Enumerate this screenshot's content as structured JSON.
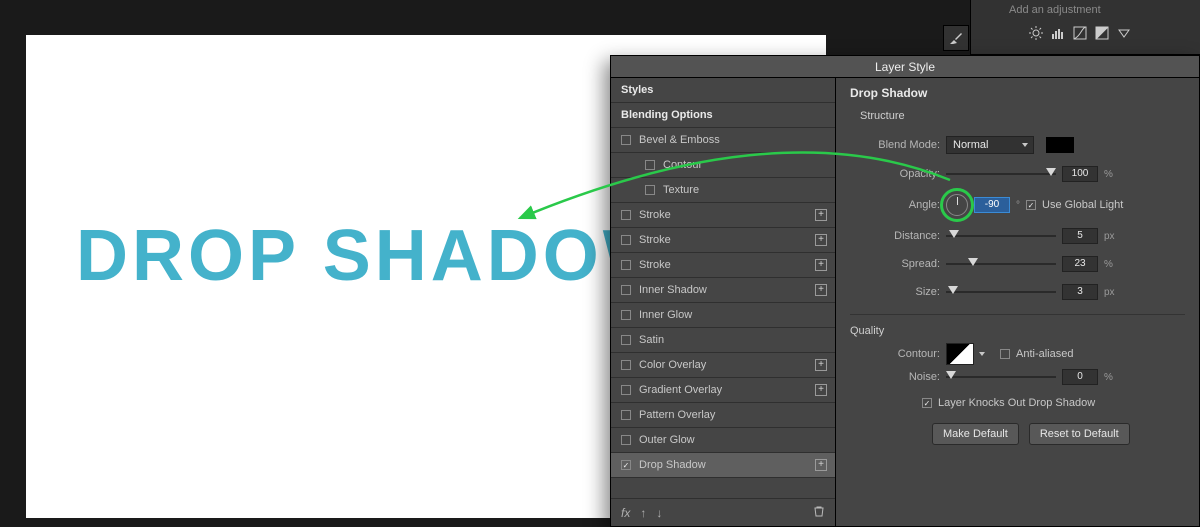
{
  "canvas": {
    "text": "DROP SHADOWS"
  },
  "adjustments": {
    "hint": "Add an adjustment"
  },
  "dialog": {
    "title": "Layer Style",
    "sidebar": {
      "header_styles": "Styles",
      "header_blending": "Blending Options",
      "items": {
        "bevel": "Bevel & Emboss",
        "contour": "Contour",
        "texture": "Texture",
        "stroke1": "Stroke",
        "stroke2": "Stroke",
        "stroke3": "Stroke",
        "inner_shadow": "Inner Shadow",
        "inner_glow": "Inner Glow",
        "satin": "Satin",
        "color_overlay": "Color Overlay",
        "gradient_overlay": "Gradient Overlay",
        "pattern_overlay": "Pattern Overlay",
        "outer_glow": "Outer Glow",
        "drop_shadow": "Drop Shadow"
      },
      "footer_fx": "fx"
    },
    "main": {
      "title": "Drop Shadow",
      "structure_label": "Structure",
      "blend_mode_label": "Blend Mode:",
      "blend_mode_value": "Normal",
      "opacity_label": "Opacity:",
      "opacity_value": "100",
      "opacity_unit": "%",
      "angle_label": "Angle:",
      "angle_value": "-90",
      "angle_unit": "°",
      "use_global_light": "Use Global Light",
      "distance_label": "Distance:",
      "distance_value": "5",
      "distance_unit": "px",
      "spread_label": "Spread:",
      "spread_value": "23",
      "spread_unit": "%",
      "size_label": "Size:",
      "size_value": "3",
      "size_unit": "px",
      "quality_label": "Quality",
      "contour_label": "Contour:",
      "anti_aliased": "Anti-aliased",
      "noise_label": "Noise:",
      "noise_value": "0",
      "noise_unit": "%",
      "layer_knocks_out": "Layer Knocks Out Drop Shadow",
      "make_default": "Make Default",
      "reset_default": "Reset to Default"
    }
  }
}
